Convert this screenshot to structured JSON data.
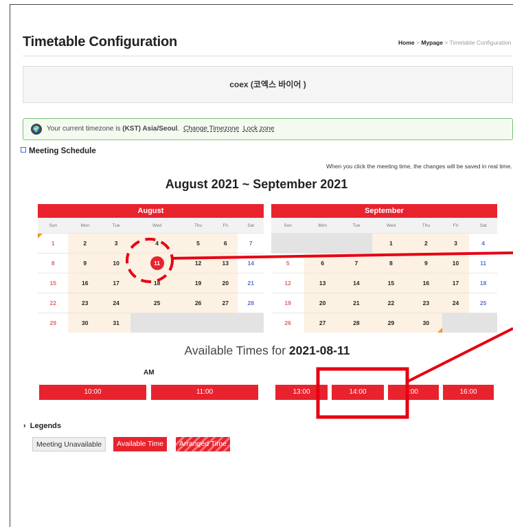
{
  "page": {
    "title": "Timetable Configuration",
    "breadcrumb": {
      "home": "Home",
      "sep1": " > ",
      "mypage": "Mypage",
      "sep2": " > ",
      "current": "Timetable Configuration"
    },
    "company": "coex (코엑스 바이어 )"
  },
  "timezone": {
    "icon": "globe-icon",
    "prefix": "Your current timezone is ",
    "zone": "(KST) Asia/Seoul",
    "period": ".",
    "change_link": "Change Timezone",
    "lock_link": "Lock zone"
  },
  "schedule": {
    "section_title": "Meeting Schedule",
    "hint": "When you click the meeting time, the changes will be saved in real time.",
    "range_title": "August 2021 ~ September 2021",
    "weekdays": [
      "Sun",
      "Mon",
      "Tue",
      "Wed",
      "Thu",
      "Fri",
      "Sat"
    ],
    "months": [
      {
        "name": "August",
        "weeks": [
          [
            "1",
            "2",
            "3",
            "4",
            "5",
            "6",
            "7"
          ],
          [
            "8",
            "9",
            "10",
            "11",
            "12",
            "13",
            "14"
          ],
          [
            "15",
            "16",
            "17",
            "18",
            "19",
            "20",
            "21"
          ],
          [
            "22",
            "23",
            "24",
            "25",
            "26",
            "27",
            "28"
          ],
          [
            "29",
            "30",
            "31",
            "",
            "",
            "",
            ""
          ]
        ]
      },
      {
        "name": "September",
        "weeks": [
          [
            "",
            "",
            "",
            "1",
            "2",
            "3",
            "4"
          ],
          [
            "5",
            "6",
            "7",
            "8",
            "9",
            "10",
            "11"
          ],
          [
            "12",
            "13",
            "14",
            "15",
            "16",
            "17",
            "18"
          ],
          [
            "19",
            "20",
            "21",
            "22",
            "23",
            "24",
            "25"
          ],
          [
            "26",
            "27",
            "28",
            "29",
            "30",
            "",
            ""
          ]
        ]
      }
    ],
    "selected_day": "11"
  },
  "available": {
    "prefix": "Available Times for ",
    "date": "2021-08-11",
    "am_label": "AM",
    "slots": [
      "10:00",
      "11:00",
      "13:00",
      "14:00",
      ":00",
      "16:00"
    ]
  },
  "legends": {
    "title": "Legends",
    "unavailable": "Meeting Unavailable",
    "available": "Available Time",
    "arranged": "Arranged Time"
  },
  "colors": {
    "accent": "#e8232e",
    "weekday_bg": "#fdf1e3",
    "empty_bg": "#e3e3e3",
    "sunday": "#e06666",
    "saturday": "#5b6fd3",
    "annotation": "#e60012"
  }
}
